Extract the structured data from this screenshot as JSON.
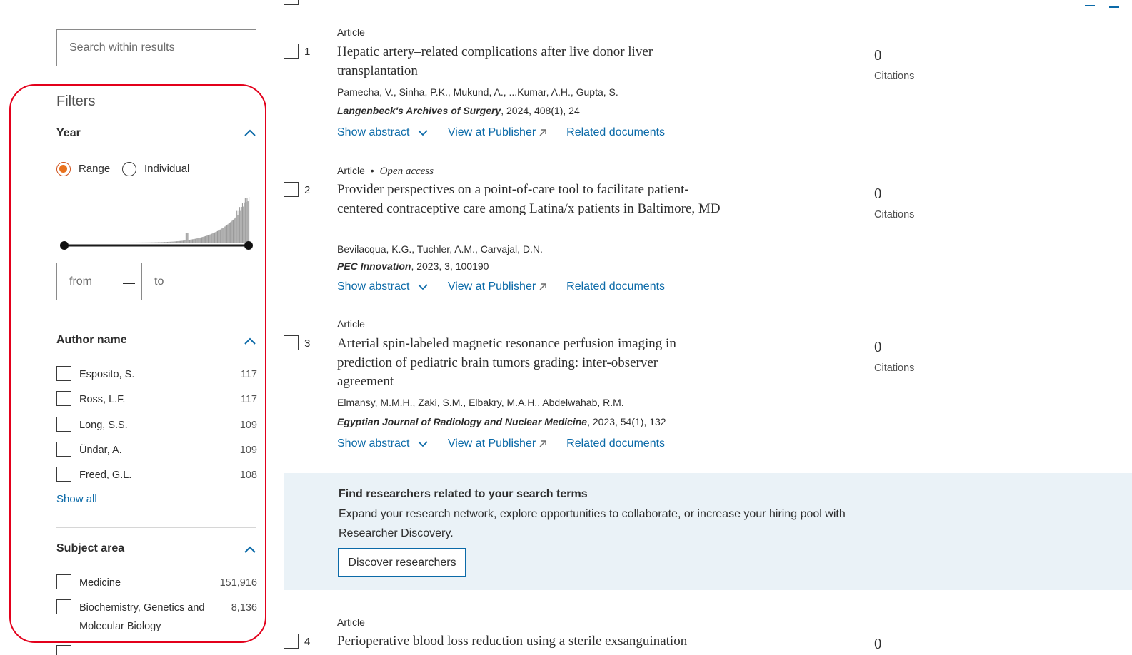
{
  "search": {
    "placeholder": "Search within results"
  },
  "filters": {
    "title": "Filters",
    "year": {
      "title": "Year",
      "range_label": "Range",
      "individual_label": "Individual",
      "selected": "Range",
      "from_placeholder": "from",
      "to_placeholder": "to"
    },
    "author": {
      "title": "Author name",
      "items": [
        {
          "label": "Esposito, S.",
          "count": "117"
        },
        {
          "label": "Ross, L.F.",
          "count": "117"
        },
        {
          "label": "Long, S.S.",
          "count": "109"
        },
        {
          "label": "Ündar, A.",
          "count": "109"
        },
        {
          "label": "Freed, G.L.",
          "count": "108"
        }
      ],
      "show_all": "Show all"
    },
    "subject": {
      "title": "Subject area",
      "items": [
        {
          "label": "Medicine",
          "count": "151,916"
        },
        {
          "label": "Biochemistry, Genetics and",
          "label2": "Molecular Biology",
          "count": "8,136"
        }
      ]
    }
  },
  "results": [
    {
      "num": "1",
      "type": "Article",
      "title": "Hepatic artery–related complications after live donor liver transplantation",
      "authors": "Pamecha, V., Sinha, P.K., Mukund, A., ...Kumar, A.H., Gupta, S.",
      "source_name": "Langenbeck's Archives of Surgery",
      "source_rest": ", 2024, 408(1), 24",
      "citations": "0",
      "citations_label": "Citations"
    },
    {
      "num": "2",
      "type": "Article",
      "open_access": "Open access",
      "title": "Provider perspectives on a point-of-care tool to facilitate patient-centered contraceptive care among Latina/x patients in Baltimore, MD",
      "authors": "Bevilacqua, K.G., Tuchler, A.M., Carvajal, D.N.",
      "source_name": "PEC Innovation",
      "source_rest": ", 2023, 3, 100190",
      "citations": "0",
      "citations_label": "Citations"
    },
    {
      "num": "3",
      "type": "Article",
      "title": "Arterial spin-labeled magnetic resonance perfusion imaging in prediction of pediatric brain tumors grading: inter-observer agreement",
      "authors": "Elmansy, M.M.H., Zaki, S.M., Elbakry, M.A.H., Abdelwahab, R.M.",
      "source_name": "Egyptian Journal of Radiology and Nuclear Medicine",
      "source_rest": ", 2023, 54(1), 132",
      "citations": "0",
      "citations_label": "Citations"
    },
    {
      "num": "4",
      "type": "Article",
      "title": "Perioperative blood loss reduction using a sterile exsanguination",
      "citations": "0"
    }
  ],
  "actions": {
    "show_abstract": "Show abstract",
    "view_publisher": "View at Publisher",
    "related": "Related documents"
  },
  "promo": {
    "title": "Find researchers related to your search terms",
    "text": "Expand your research network, explore opportunities to collaborate, or increase your hiring pool with Researcher Discovery.",
    "button": "Discover researchers"
  },
  "colors": {
    "accent": "#0b6aa8",
    "radio_on": "#e9711c",
    "highlight": "#e3001b",
    "promo_bg": "#eaf2f7"
  }
}
